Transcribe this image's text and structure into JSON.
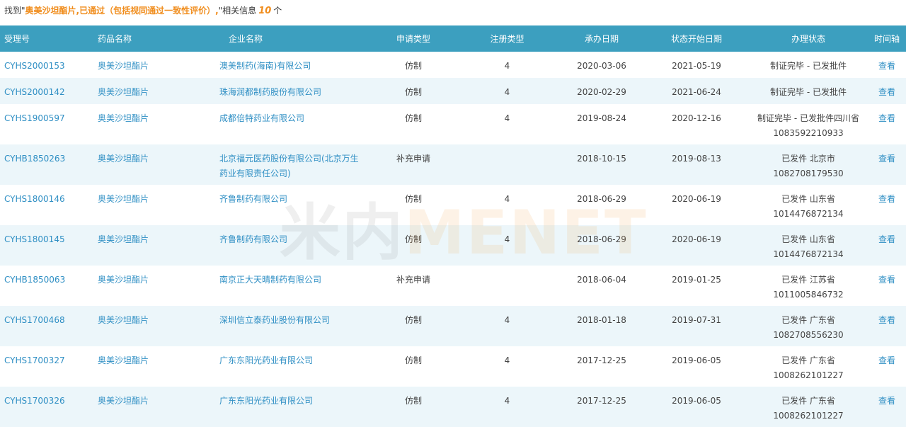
{
  "summary": {
    "prefix": "找到\"",
    "query": "奥美沙坦酯片,已通过（包括视同通过一致性评价）,",
    "mid": "\"相关信息",
    "count": "10",
    "suffix": "个"
  },
  "headers": [
    "受理号",
    "药品名称",
    "企业名称",
    "申请类型",
    "注册类型",
    "承办日期",
    "状态开始日期",
    "办理状态",
    "时间轴"
  ],
  "rows": [
    {
      "id": "CYHS2000153",
      "drug": "奥美沙坦酯片",
      "company": "澳美制药(海南)有限公司",
      "app_type": "仿制",
      "reg_type": "4",
      "date1": "2020-03-06",
      "date2": "2021-05-19",
      "status": "制证完毕 - 已发批件",
      "view": "查看"
    },
    {
      "id": "CYHS2000142",
      "drug": "奥美沙坦酯片",
      "company": "珠海润都制药股份有限公司",
      "app_type": "仿制",
      "reg_type": "4",
      "date1": "2020-02-29",
      "date2": "2021-06-24",
      "status": "制证完毕 - 已发批件",
      "view": "查看"
    },
    {
      "id": "CYHS1900597",
      "drug": "奥美沙坦酯片",
      "company": "成都倍特药业有限公司",
      "app_type": "仿制",
      "reg_type": "4",
      "date1": "2019-08-24",
      "date2": "2020-12-16",
      "status": "制证完毕 - 已发批件四川省 1083592210933",
      "view": "查看"
    },
    {
      "id": "CYHB1850263",
      "drug": "奥美沙坦酯片",
      "company": "北京福元医药股份有限公司(北京万生药业有限责任公司)",
      "app_type": "补充申请",
      "reg_type": "",
      "date1": "2018-10-15",
      "date2": "2019-08-13",
      "status": "已发件 北京市 1082708179530",
      "view": "查看"
    },
    {
      "id": "CYHS1800146",
      "drug": "奥美沙坦酯片",
      "company": "齐鲁制药有限公司",
      "app_type": "仿制",
      "reg_type": "4",
      "date1": "2018-06-29",
      "date2": "2020-06-19",
      "status": "已发件 山东省 1014476872134",
      "view": "查看"
    },
    {
      "id": "CYHS1800145",
      "drug": "奥美沙坦酯片",
      "company": "齐鲁制药有限公司",
      "app_type": "仿制",
      "reg_type": "4",
      "date1": "2018-06-29",
      "date2": "2020-06-19",
      "status": "已发件 山东省 1014476872134",
      "view": "查看"
    },
    {
      "id": "CYHB1850063",
      "drug": "奥美沙坦酯片",
      "company": "南京正大天晴制药有限公司",
      "app_type": "补充申请",
      "reg_type": "",
      "date1": "2018-06-04",
      "date2": "2019-01-25",
      "status": "已发件 江苏省 1011005846732",
      "view": "查看"
    },
    {
      "id": "CYHS1700468",
      "drug": "奥美沙坦酯片",
      "company": "深圳信立泰药业股份有限公司",
      "app_type": "仿制",
      "reg_type": "4",
      "date1": "2018-01-18",
      "date2": "2019-07-31",
      "status": "已发件 广东省 1082708556230",
      "view": "查看"
    },
    {
      "id": "CYHS1700327",
      "drug": "奥美沙坦酯片",
      "company": "广东东阳光药业有限公司",
      "app_type": "仿制",
      "reg_type": "4",
      "date1": "2017-12-25",
      "date2": "2019-06-05",
      "status": "已发件 广东省 1008262101227",
      "view": "查看"
    },
    {
      "id": "CYHS1700326",
      "drug": "奥美沙坦酯片",
      "company": "广东东阳光药业有限公司",
      "app_type": "仿制",
      "reg_type": "4",
      "date1": "2017-12-25",
      "date2": "2019-06-05",
      "status": "已发件 广东省 1008262101227",
      "view": "查看"
    }
  ],
  "watermark": {
    "cn": "米内",
    "en": "MENET"
  },
  "colors": {
    "header_bg": "#3c9fbf",
    "link": "#2f8fc4",
    "highlight": "#f08c1b",
    "stripe": "#ecf6fa"
  }
}
